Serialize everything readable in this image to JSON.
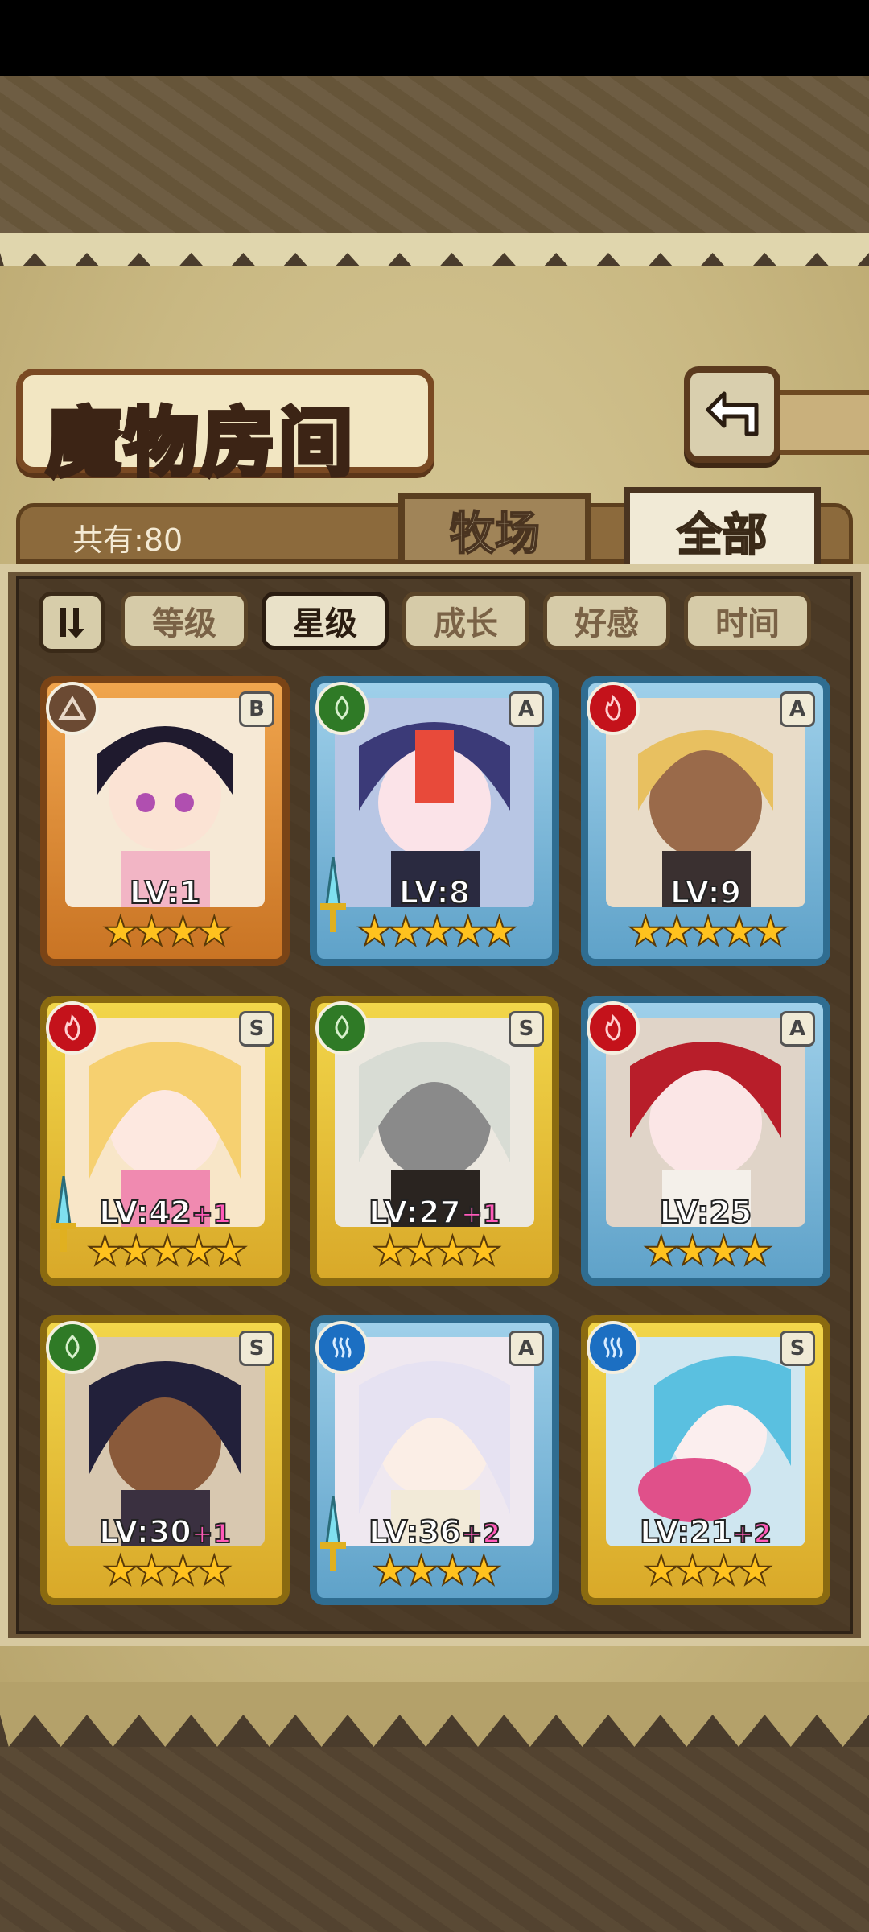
{
  "header": {
    "title": "魔物房间"
  },
  "summary": {
    "count_label": "共有:80"
  },
  "tabs": {
    "farm": "牧场",
    "all": "全部"
  },
  "filters": [
    {
      "label": "等级",
      "active": false
    },
    {
      "label": "星级",
      "active": true
    },
    {
      "label": "成长",
      "active": false
    },
    {
      "label": "好感",
      "active": false
    },
    {
      "label": "时间",
      "active": false
    }
  ],
  "monsters": [
    {
      "level": "LV:1",
      "bonus": "",
      "rank": "B",
      "element": "earth",
      "frame": "bronze",
      "stars": "★★★★",
      "equipped": false
    },
    {
      "level": "LV:8",
      "bonus": "",
      "rank": "A",
      "element": "grass",
      "frame": "blue",
      "stars": "★★★★★",
      "equipped": true
    },
    {
      "level": "LV:9",
      "bonus": "",
      "rank": "A",
      "element": "fire",
      "frame": "blue",
      "stars": "★★★★★",
      "equipped": false
    },
    {
      "level": "LV:42",
      "bonus": "+1",
      "rank": "S",
      "element": "fire",
      "frame": "gold",
      "stars": "★★★★★",
      "equipped": true
    },
    {
      "level": "LV:27",
      "bonus": "+1",
      "rank": "S",
      "element": "grass",
      "frame": "gold",
      "stars": "★★★★",
      "equipped": false
    },
    {
      "level": "LV:25",
      "bonus": "",
      "rank": "A",
      "element": "fire",
      "frame": "blue",
      "stars": "★★★★",
      "equipped": false
    },
    {
      "level": "LV:30",
      "bonus": "+1",
      "rank": "S",
      "element": "grass",
      "frame": "gold",
      "stars": "★★★★",
      "equipped": false
    },
    {
      "level": "LV:36",
      "bonus": "+2",
      "rank": "A",
      "element": "water",
      "frame": "blue",
      "stars": "★★★★",
      "equipped": true
    },
    {
      "level": "LV:21",
      "bonus": "+2",
      "rank": "S",
      "element": "water",
      "frame": "gold",
      "stars": "★★★★",
      "equipped": false
    }
  ],
  "colors": {
    "fire": "#c4121b",
    "grass": "#2f7a26",
    "water": "#1c6fc2",
    "earth": "#6b4a33"
  }
}
